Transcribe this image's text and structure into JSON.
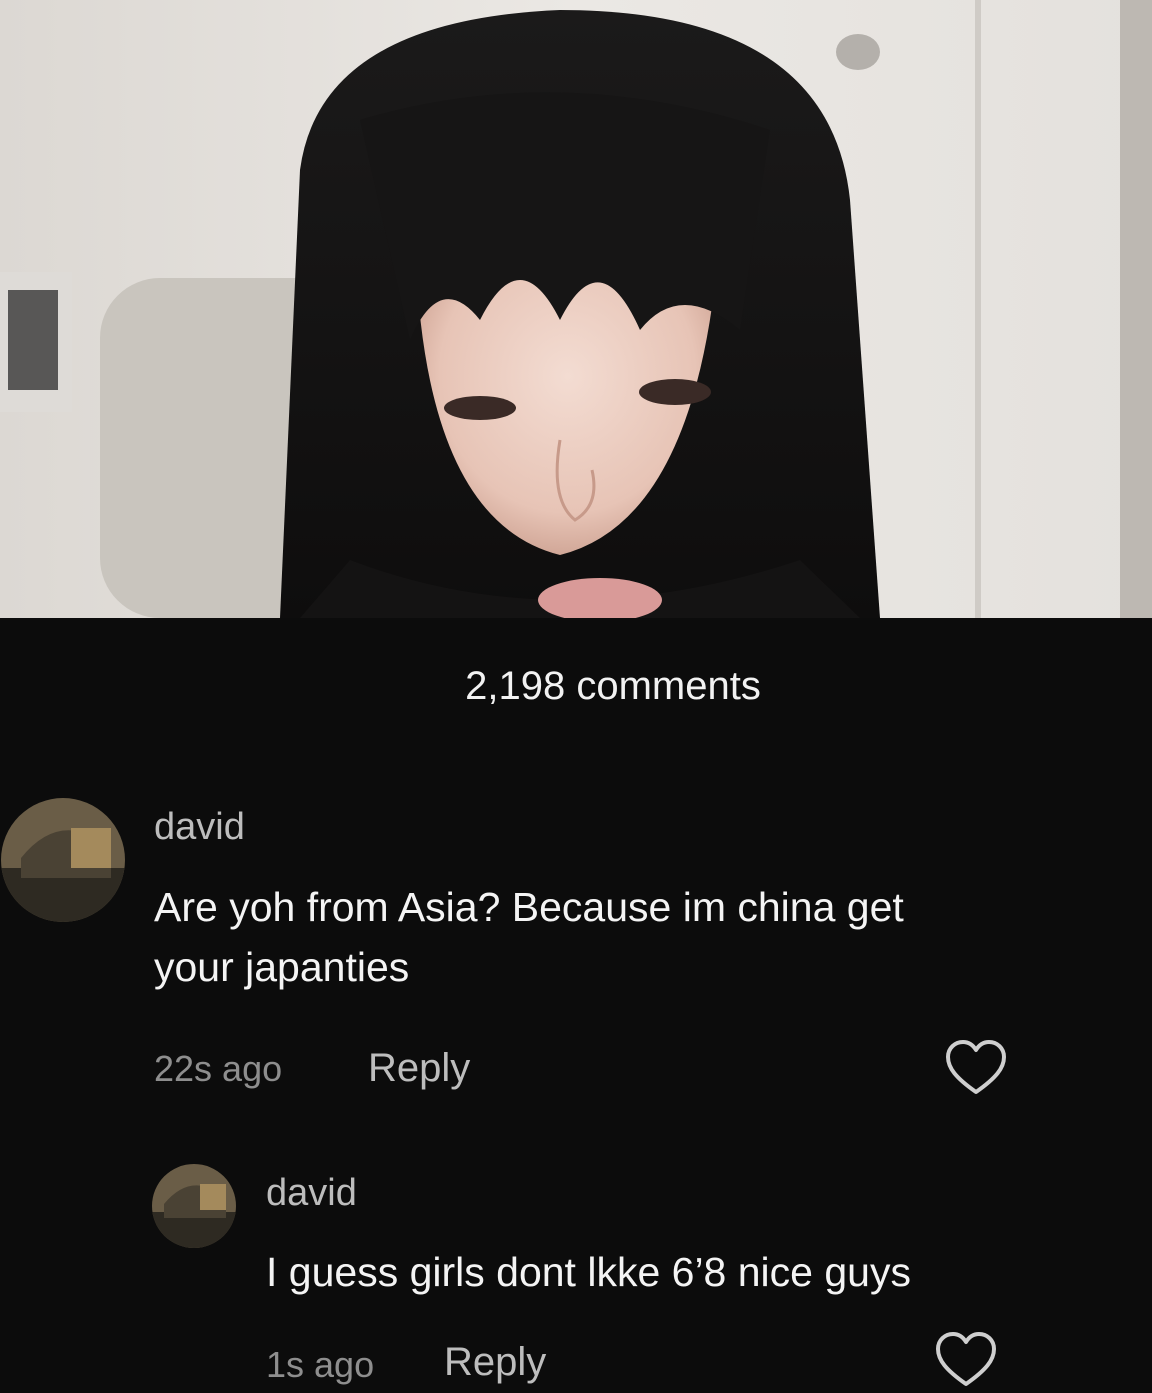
{
  "comments_header": {
    "count_label": "2,198 comments"
  },
  "comments": [
    {
      "username": "david",
      "text_line1": "Are yoh from Asia? Because im china get",
      "text_line2": "your japanties",
      "time": "22s ago",
      "reply_label": "Reply"
    },
    {
      "username": "david",
      "text_line1": "I guess girls dont lkke 6’8 nice guys",
      "time": "1s ago",
      "reply_label": "Reply"
    }
  ],
  "icons": {
    "like": "heart-outline-icon",
    "avatar": "user-avatar-icon"
  },
  "colors": {
    "sheet_background": "#0c0c0c",
    "primary_text": "#f4f4f4",
    "secondary_text": "#8e8e8e"
  }
}
